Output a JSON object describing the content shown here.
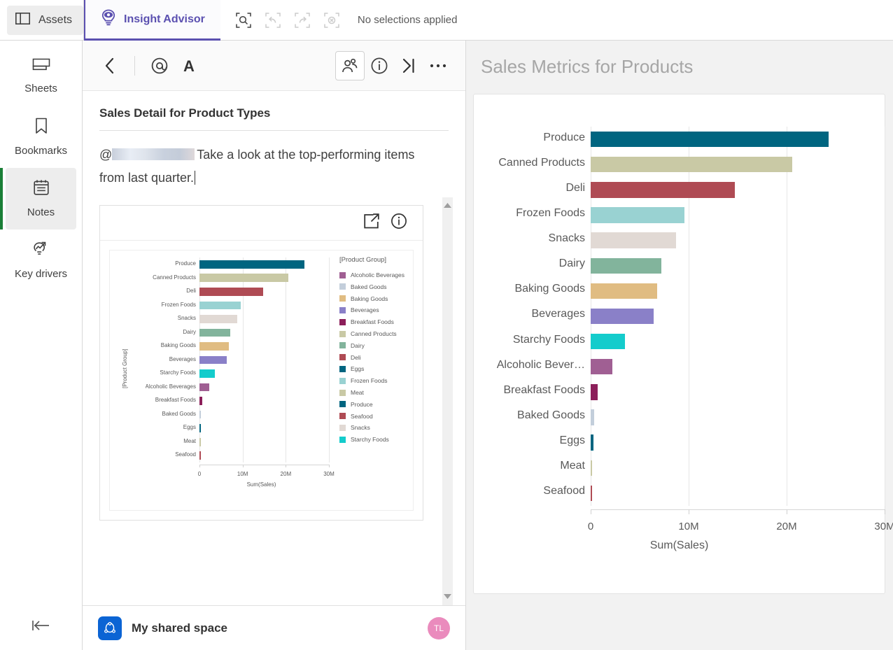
{
  "topbar": {
    "assets_label": "Assets",
    "assets_icon": "panel-layout-icon",
    "insight_advisor_label": "Insight Advisor",
    "insight_advisor_icon": "lightbulb-eye-icon",
    "selection_tools": [
      {
        "name": "selection-search-icon",
        "enabled": true
      },
      {
        "name": "undo-selection-icon",
        "enabled": false
      },
      {
        "name": "redo-selection-icon",
        "enabled": false
      },
      {
        "name": "clear-selections-icon",
        "enabled": false
      }
    ],
    "selection_status": "No selections applied"
  },
  "rail": {
    "items": [
      {
        "label": "Sheets",
        "icon": "sheets-icon",
        "active": false
      },
      {
        "label": "Bookmarks",
        "icon": "bookmark-icon",
        "active": false
      },
      {
        "label": "Notes",
        "icon": "notes-icon",
        "active": true
      },
      {
        "label": "Key drivers",
        "icon": "key-drivers-icon",
        "active": false
      }
    ],
    "collapse_icon": "collapse-left-icon"
  },
  "note_panel": {
    "toolbar": [
      {
        "name": "back-button",
        "icon": "chevron-left-icon"
      },
      {
        "name": "mention-button",
        "icon": "at-icon"
      },
      {
        "name": "text-format-button",
        "icon": "font-a-icon"
      },
      {
        "name": "collaborators-button",
        "icon": "people-icon",
        "boxed": true
      },
      {
        "name": "info-button",
        "icon": "info-circle-icon"
      },
      {
        "name": "collapse-panel-button",
        "icon": "chevron-right-bar-icon"
      },
      {
        "name": "more-options-button",
        "icon": "ellipsis-icon"
      }
    ],
    "title": "Sales Detail for Product Types",
    "body_mention": "@",
    "body_text": "Take a look at the top-performing items from last quarter.",
    "embed_actions": [
      {
        "name": "open-chart-icon"
      },
      {
        "name": "info-circle-icon"
      }
    ],
    "footer": {
      "space_name": "My shared space",
      "space_icon": "shared-space-icon",
      "avatar_initials": "TL",
      "avatar_color": "#ea8bbd"
    },
    "scrollbar": {
      "up_icon": "scroll-up-arrow-icon",
      "down_icon": "scroll-down-arrow-icon"
    }
  },
  "main": {
    "title": "Sales Metrics for Products"
  },
  "colors": {
    "accent_purple": "#5b50b0",
    "active_green": "#1a7f37",
    "space_blue": "#0b64d4"
  },
  "chart_data": [
    {
      "id": "main-chart",
      "type": "bar",
      "orientation": "horizontal",
      "title": "Sales Metrics for Products",
      "xlabel": "Sum(Sales)",
      "ylabel": "",
      "xlim": [
        0,
        30000000
      ],
      "xticks": [
        0,
        10000000,
        20000000,
        30000000
      ],
      "xticklabels": [
        "0",
        "10M",
        "20M",
        "30M"
      ],
      "grid": true,
      "legend": false,
      "categories": [
        "Produce",
        "Canned Products",
        "Deli",
        "Frozen Foods",
        "Snacks",
        "Dairy",
        "Baking Goods",
        "Beverages",
        "Starchy Foods",
        "Alcoholic Bever…",
        "Breakfast Foods",
        "Baked Goods",
        "Eggs",
        "Meat",
        "Seafood"
      ],
      "values": [
        24300000,
        20600000,
        14700000,
        9600000,
        8700000,
        7200000,
        6800000,
        6400000,
        3500000,
        2200000,
        700000,
        350000,
        280000,
        60000,
        40000
      ],
      "bar_colors": [
        "#006580",
        "#c9c9a5",
        "#af4b54",
        "#99d2d2",
        "#e1d9d4",
        "#82b49c",
        "#e0bc82",
        "#8a80c8",
        "#14cccc",
        "#a05f93",
        "#8c1f5a",
        "#c3cedb",
        "#006580",
        "#c9c9a5",
        "#af4b54"
      ]
    },
    {
      "id": "embedded-chart",
      "type": "bar",
      "orientation": "horizontal",
      "title": "",
      "xlabel": "Sum(Sales)",
      "ylabel": "[Product Group]",
      "xlim": [
        0,
        30000000
      ],
      "xticks": [
        0,
        10000000,
        20000000,
        30000000
      ],
      "xticklabels": [
        "0",
        "10M",
        "20M",
        "30M"
      ],
      "grid": true,
      "legend": true,
      "legend_position": "right",
      "legend_title": "[Product Group]",
      "categories": [
        "Produce",
        "Canned Products",
        "Deli",
        "Frozen Foods",
        "Snacks",
        "Dairy",
        "Baking Goods",
        "Beverages",
        "Starchy Foods",
        "Alcoholic Beverages",
        "Breakfast Foods",
        "Baked Goods",
        "Eggs",
        "Meat",
        "Seafood"
      ],
      "values": [
        24300000,
        20600000,
        14700000,
        9600000,
        8700000,
        7200000,
        6800000,
        6400000,
        3500000,
        2200000,
        700000,
        350000,
        280000,
        60000,
        40000
      ],
      "bar_colors": [
        "#006580",
        "#c9c9a5",
        "#af4b54",
        "#99d2d2",
        "#e1d9d4",
        "#82b49c",
        "#e0bc82",
        "#8a80c8",
        "#14cccc",
        "#a05f93",
        "#8c1f5a",
        "#c3cedb",
        "#006580",
        "#c9c9a5",
        "#af4b54"
      ],
      "legend_entries": [
        {
          "label": "Alcoholic Beverages",
          "color": "#a05f93"
        },
        {
          "label": "Baked Goods",
          "color": "#c3cedb"
        },
        {
          "label": "Baking Goods",
          "color": "#e0bc82"
        },
        {
          "label": "Beverages",
          "color": "#8a80c8"
        },
        {
          "label": "Breakfast Foods",
          "color": "#8c1f5a"
        },
        {
          "label": "Canned Products",
          "color": "#c9c9a5"
        },
        {
          "label": "Dairy",
          "color": "#82b49c"
        },
        {
          "label": "Deli",
          "color": "#af4b54"
        },
        {
          "label": "Eggs",
          "color": "#006580"
        },
        {
          "label": "Frozen Foods",
          "color": "#99d2d2"
        },
        {
          "label": "Meat",
          "color": "#c9c9a5"
        },
        {
          "label": "Produce",
          "color": "#006580"
        },
        {
          "label": "Seafood",
          "color": "#af4b54"
        },
        {
          "label": "Snacks",
          "color": "#e1d9d4"
        },
        {
          "label": "Starchy Foods",
          "color": "#14cccc"
        }
      ]
    }
  ]
}
